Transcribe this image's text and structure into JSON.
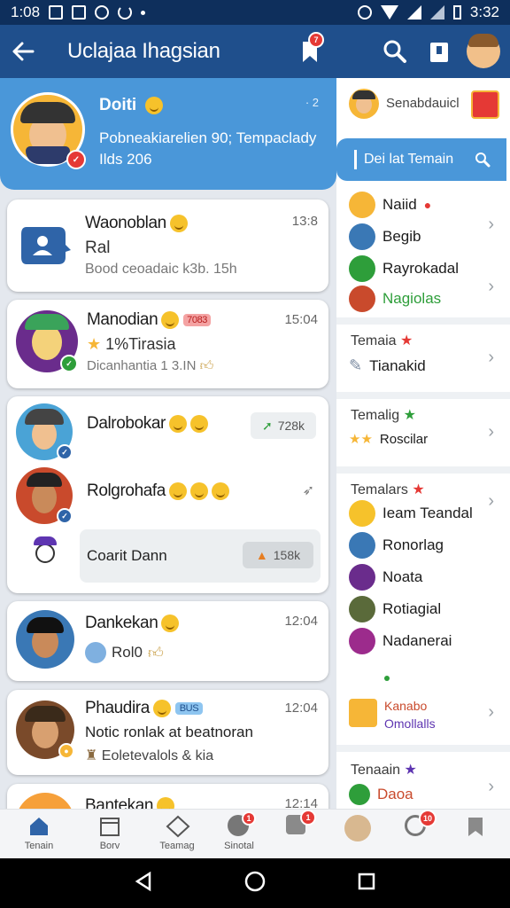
{
  "status": {
    "time": "1:08",
    "time_right": "3:32"
  },
  "appbar": {
    "title": "Uclajaa Ihagsian",
    "notif_count": "7"
  },
  "hero": {
    "name": "Doiti",
    "counter": "· 2",
    "line1": "Pobneakiarelien 90; Tempaclady",
    "line2": "Ilds 206"
  },
  "chats": [
    {
      "name": "Waonoblan",
      "time": "13:8",
      "line1": "Ral",
      "line2": "Bood ceoadaic k3b. 15h"
    },
    {
      "name": "Manodian",
      "tag": "7083",
      "time": "15:04",
      "line1": "1%Tirasia",
      "line2": "Dicanhantia 1 3.IN"
    },
    {
      "name": "Dalrobokar",
      "pill": "728k"
    },
    {
      "name": "Rolgrohafa"
    },
    {
      "name": "Coarit Dann",
      "pill": "158k"
    },
    {
      "name": "Dankekan",
      "time": "12:04",
      "line1": "Rol0"
    },
    {
      "name": "Phaudira",
      "tag": "BUS",
      "time": "12:04",
      "line1": "Notic ronlak at beatnoran",
      "line2": "Eoletevalols & kia"
    },
    {
      "name": "Bantekan",
      "time": "12:14"
    }
  ],
  "right": {
    "top_label": "Senabdauicl",
    "search_label": "Dei lat Temain",
    "people1": [
      {
        "name": "Naiid"
      },
      {
        "name": "Begib"
      },
      {
        "name": "Rayrokadal"
      },
      {
        "name": "Nagiolas",
        "color": "#2e9e3a"
      }
    ],
    "sections": [
      {
        "title": "Temaia",
        "star": "#e53935",
        "item": "Tianakid"
      },
      {
        "title": "Temalig",
        "star": "#2e9e3a",
        "item": "Roscilar"
      },
      {
        "title": "Temalars",
        "star": "#e53935"
      }
    ],
    "people2": [
      {
        "name": "Ieam Teandal"
      },
      {
        "name": "Ronorlag"
      },
      {
        "name": "Noata"
      },
      {
        "name": "Rotiagial"
      },
      {
        "name": "Nadanerai"
      }
    ],
    "promo": {
      "line1": "Kanabo",
      "line2": "Omollalls"
    },
    "last": {
      "title": "Tenaain",
      "star": "#5e35b1",
      "item": "Daoa"
    }
  },
  "nav": [
    {
      "label": "Tenain",
      "icon": "home-icon"
    },
    {
      "label": "Borv",
      "icon": "calendar-icon"
    },
    {
      "label": "Teamag",
      "icon": "team-icon"
    },
    {
      "label": "Sinotal",
      "icon": "notify-icon",
      "badge": "1"
    },
    {
      "label": "",
      "icon": "chat-icon",
      "badge": "1"
    },
    {
      "label": "",
      "icon": "profile-icon"
    },
    {
      "label": "",
      "icon": "alert-icon",
      "badge": "10"
    },
    {
      "label": "",
      "icon": "bookmark-icon"
    }
  ],
  "colors": {
    "appbar": "#1f4f8c",
    "accent": "#4a97d9",
    "hero": "#4a97d9"
  }
}
